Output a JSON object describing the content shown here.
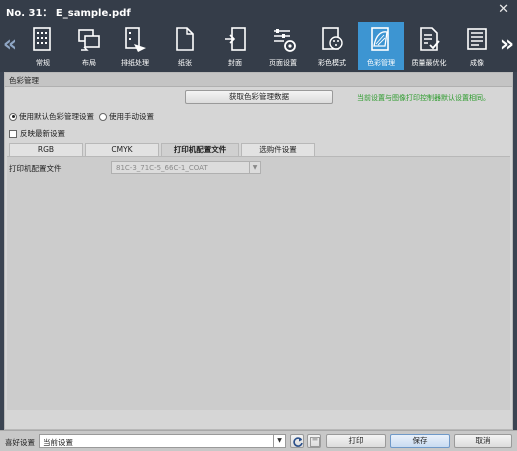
{
  "window": {
    "title": "No. 31： E_sample.pdf",
    "close_glyph": "✕"
  },
  "toolbar": {
    "left_arrow": "«",
    "right_arrow": "»",
    "items": [
      {
        "label": "常规",
        "icon": "basic-settings-icon"
      },
      {
        "label": "布局",
        "icon": "layout-icon"
      },
      {
        "label": "排纸处理",
        "icon": "finishing-icon"
      },
      {
        "label": "纸张",
        "icon": "paper-icon"
      },
      {
        "label": "封面",
        "icon": "cover-icon"
      },
      {
        "label": "页面设置",
        "icon": "page-setup-icon"
      },
      {
        "label": "彩色模式",
        "icon": "color-mode-icon"
      },
      {
        "label": "色彩管理",
        "icon": "color-management-icon",
        "active": true
      },
      {
        "label": "质量最优化",
        "icon": "quality-icon"
      },
      {
        "label": "成像",
        "icon": "imaging-icon"
      }
    ]
  },
  "section": {
    "title": "色彩管理",
    "get_data_button": "获取色彩管理数据",
    "note": "当前设置与图像打印控制器默认设置相同。",
    "radio_default": "使用默认色彩管理设置",
    "radio_manual": "使用手动设置",
    "checkbox_latest": "反映最新设置",
    "tabs": [
      "RGB",
      "CMYK",
      "打印机配置文件",
      "选购件设置"
    ],
    "active_tab": 2,
    "printer_profile_label": "打印机配置文件",
    "printer_profile_value": "81C-3_71C-5_66C-1_COAT"
  },
  "footer": {
    "favorite_label": "喜好设置",
    "favorite_value": "当前设置",
    "print_button": "打印",
    "save_button": "保存",
    "cancel_button": "取消"
  },
  "colors": {
    "active_tab_bg": "#3d95d2",
    "note_green": "#2c9b2c",
    "toolbar_bg": "#353d49"
  }
}
